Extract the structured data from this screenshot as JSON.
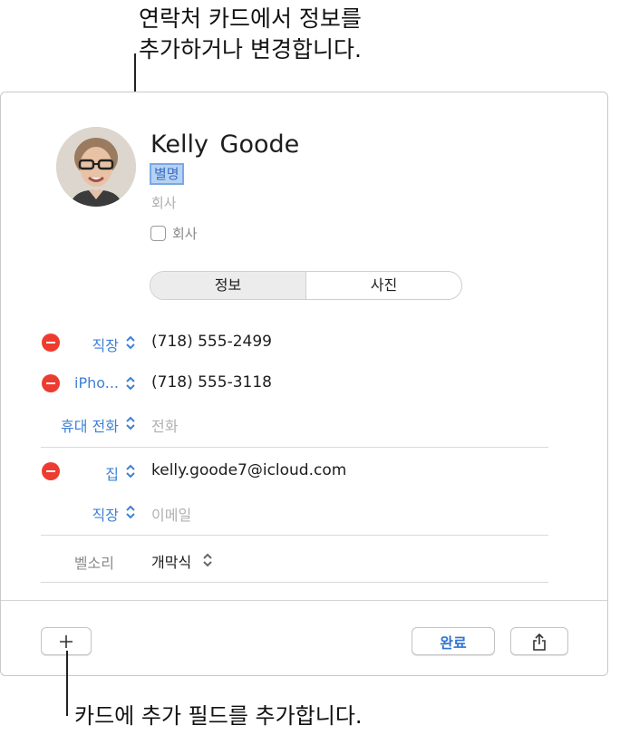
{
  "callouts": {
    "top_line1": "연락처 카드에서 정보를",
    "top_line2": "추가하거나 변경합니다.",
    "bottom": "카드에 추가 필드를 추가합니다."
  },
  "contact": {
    "name": "Kelly  Goode",
    "nickname": "별명",
    "company_placeholder": "회사",
    "company_checkbox_label": "회사"
  },
  "tabs": [
    "정보",
    "사진"
  ],
  "phones": [
    {
      "label": "직장",
      "value": "(718) 555-2499"
    },
    {
      "label": "iPho...",
      "value": "(718) 555-3118"
    },
    {
      "label": "휴대 전화",
      "placeholder": "전화"
    }
  ],
  "emails": [
    {
      "label": "집",
      "value": "kelly.goode7@icloud.com"
    },
    {
      "label": "직장",
      "placeholder": "이메일"
    }
  ],
  "ringtone": {
    "label": "벨소리",
    "value": "개막식"
  },
  "footer": {
    "done_label": "완료"
  },
  "colors": {
    "accent": "#3d80d8",
    "remove": "#ee3b30",
    "selection": "#b7d1f2"
  },
  "icons": [
    "plus-icon",
    "share-icon",
    "up-down-chevron-icon",
    "remove-icon"
  ]
}
